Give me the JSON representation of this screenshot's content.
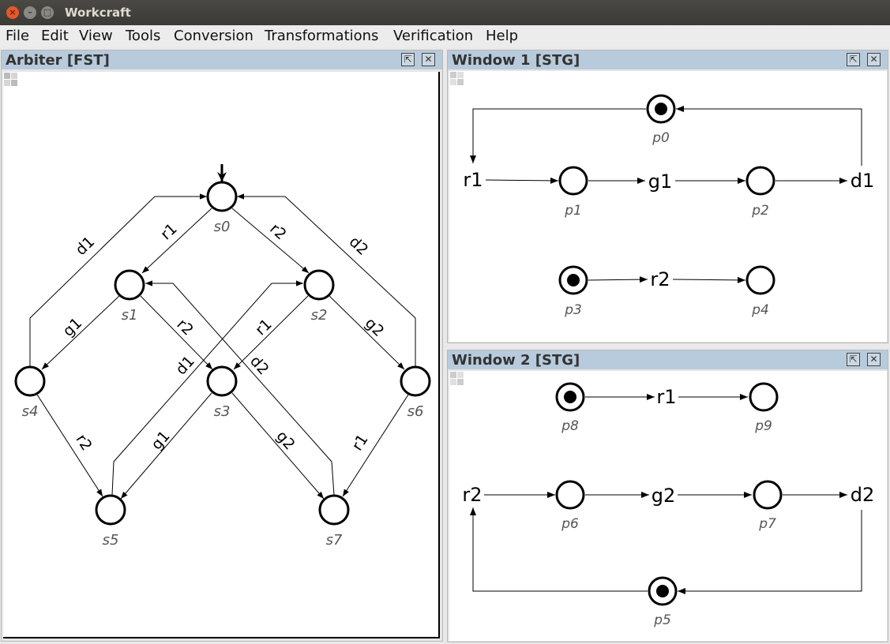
{
  "window": {
    "title": "Workcraft"
  },
  "menu": [
    "File",
    "Edit",
    "View",
    "Tools",
    "Conversion",
    "Transformations",
    "Verification",
    "Help"
  ],
  "panels": {
    "arbiter": {
      "title": "Arbiter [FST]"
    },
    "window1": {
      "title": "Window 1 [STG]"
    },
    "window2": {
      "title": "Window 2 [STG]"
    }
  },
  "fst": {
    "states": [
      "s0",
      "s1",
      "s2",
      "s3",
      "s4",
      "s5",
      "s6",
      "s7"
    ],
    "edge_labels": {
      "s0_s1": "r1",
      "s0_s2": "r2",
      "s4_s0": "d1",
      "s6_s0": "d2",
      "s1_s4": "g1",
      "s1_s3": "r2",
      "s2_s3": "r1",
      "s2_s6": "g2",
      "s5_s2": "d1",
      "s7_s1": "d2",
      "s3_s5": "g1",
      "s3_s7": "g2",
      "s4_s5": "r2",
      "s6_s7": "r1"
    }
  },
  "stg1": {
    "places": [
      "p0",
      "p1",
      "p2",
      "p3",
      "p4"
    ],
    "transitions": [
      "r1",
      "g1",
      "d1",
      "r2"
    ],
    "marked": [
      "p0",
      "p3"
    ]
  },
  "stg2": {
    "places": [
      "p8",
      "p9",
      "p6",
      "p7",
      "p5"
    ],
    "transitions": [
      "r1",
      "r2",
      "g2",
      "d2"
    ],
    "marked": [
      "p8",
      "p5"
    ]
  }
}
